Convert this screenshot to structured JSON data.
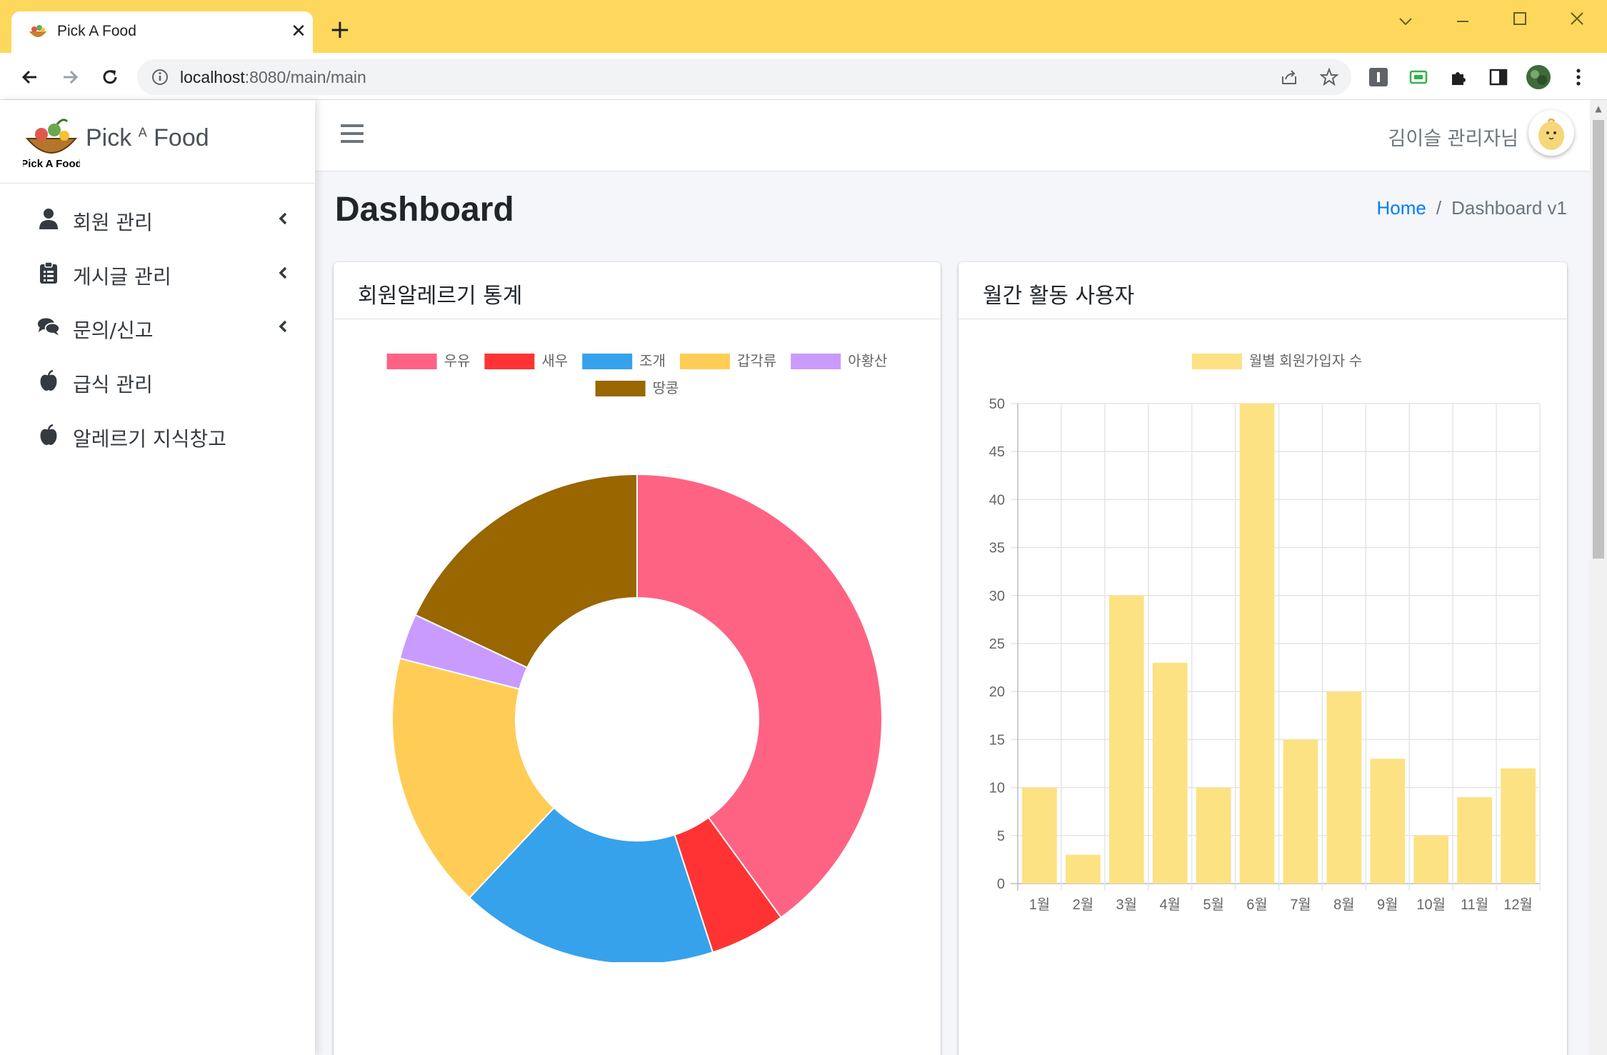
{
  "browser": {
    "tab_title": "Pick A Food",
    "tab_close": "✕",
    "new_tab": "+",
    "url_host": "localhost",
    "url_path": ":8080/main/main"
  },
  "app": {
    "brand_pre": "Pick ",
    "brand_sup": "A",
    "brand_post": " Food",
    "user_label": "김이슬 관리자님",
    "page_title": "Dashboard",
    "breadcrumb": {
      "home": "Home",
      "separator": "/",
      "current": "Dashboard v1"
    }
  },
  "sidebar": {
    "items": [
      {
        "label": "회원 관리",
        "icon": "user-icon",
        "has_children": true
      },
      {
        "label": "게시글 관리",
        "icon": "clipboard-icon",
        "has_children": true
      },
      {
        "label": "문의/신고",
        "icon": "comments-icon",
        "has_children": true
      },
      {
        "label": "급식 관리",
        "icon": "apple-icon",
        "has_children": false
      },
      {
        "label": "알레르기 지식창고",
        "icon": "apple-icon",
        "has_children": false
      }
    ]
  },
  "cards": {
    "allergy": {
      "title": "회원알레르기 통계"
    },
    "monthly": {
      "title": "월간 활동 사용자"
    }
  },
  "chart_data": [
    {
      "type": "pie",
      "variant": "doughnut",
      "legend_position": "top",
      "categories": [
        "우유",
        "새우",
        "조개",
        "갑각류",
        "아황산",
        "땅콩"
      ],
      "values": [
        40,
        5,
        17,
        17,
        3,
        18
      ],
      "colors": [
        "#ff6384",
        "#ff3333",
        "#36a2eb",
        "#ffcd56",
        "#c99bff",
        "#996600"
      ]
    },
    {
      "type": "bar",
      "legend_position": "top",
      "grid": true,
      "series": [
        {
          "name": "월별 회원가입자 수",
          "values": [
            10,
            3,
            30,
            23,
            10,
            50,
            15,
            20,
            13,
            5,
            9,
            12
          ],
          "color": "#fde283"
        }
      ],
      "categories": [
        "1월",
        "2월",
        "3월",
        "4월",
        "5월",
        "6월",
        "7월",
        "8월",
        "9월",
        "10월",
        "11월",
        "12월"
      ],
      "ylim": [
        0,
        50
      ],
      "yticks": [
        0,
        5,
        10,
        15,
        20,
        25,
        30,
        35,
        40,
        45,
        50
      ]
    }
  ]
}
